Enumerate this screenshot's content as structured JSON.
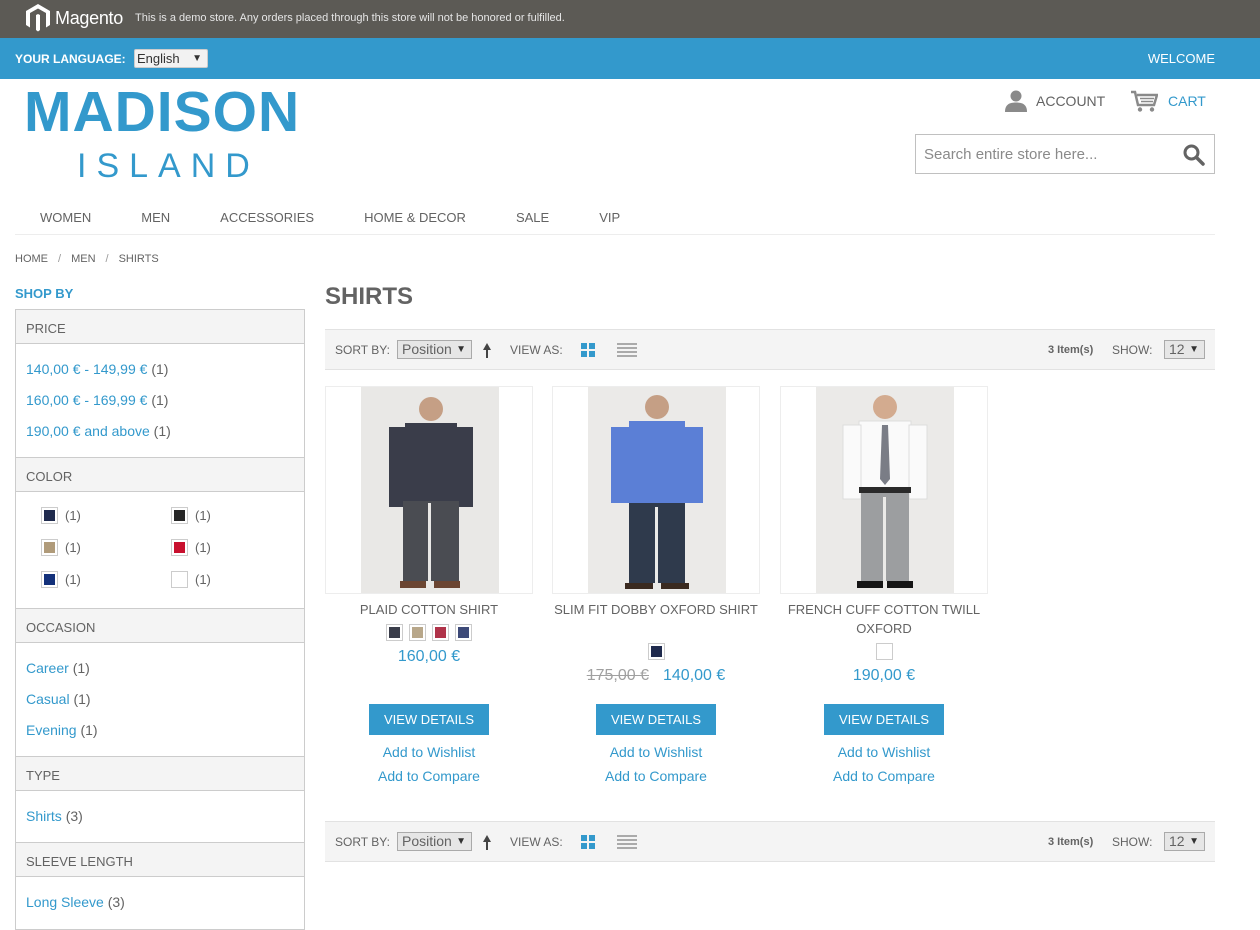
{
  "demo_bar": {
    "logo_text": "Magento",
    "notice": "This is a demo store. Any orders placed through this store will not be honored or fulfilled."
  },
  "language_bar": {
    "label": "YOUR LANGUAGE:",
    "selected": "English",
    "welcome": "WELCOME"
  },
  "header": {
    "logo_main": "MADISON",
    "logo_sub": "ISLAND",
    "account": "ACCOUNT",
    "cart": "CART",
    "search_placeholder": "Search entire store here..."
  },
  "nav": [
    "WOMEN",
    "MEN",
    "ACCESSORIES",
    "HOME & DECOR",
    "SALE",
    "VIP"
  ],
  "breadcrumb": [
    "HOME",
    "MEN",
    "SHIRTS"
  ],
  "sidebar": {
    "shop_by": "SHOP BY",
    "price": {
      "title": "PRICE",
      "items": [
        {
          "label": "140,00 € - 149,99 €",
          "count": "(1)"
        },
        {
          "label": "160,00 € - 169,99 €",
          "count": "(1)"
        },
        {
          "label": "190,00 € and above",
          "count": "(1)"
        }
      ]
    },
    "color": {
      "title": "COLOR",
      "items": [
        {
          "color": "#1f2a4d",
          "count": "(1)"
        },
        {
          "color": "#262626",
          "count": "(1)"
        },
        {
          "color": "#b09b7a",
          "count": "(1)"
        },
        {
          "color": "#c8102e",
          "count": "(1)"
        },
        {
          "color": "#13307a",
          "count": "(1)"
        },
        {
          "color": "#ffffff",
          "count": "(1)"
        }
      ]
    },
    "occasion": {
      "title": "OCCASION",
      "items": [
        {
          "label": "Career",
          "count": "(1)"
        },
        {
          "label": "Casual",
          "count": "(1)"
        },
        {
          "label": "Evening",
          "count": "(1)"
        }
      ]
    },
    "type": {
      "title": "TYPE",
      "items": [
        {
          "label": "Shirts",
          "count": "(3)"
        }
      ]
    },
    "sleeve": {
      "title": "SLEEVE LENGTH",
      "items": [
        {
          "label": "Long Sleeve",
          "count": "(3)"
        }
      ]
    }
  },
  "main": {
    "title": "SHIRTS",
    "toolbar": {
      "sort_by": "SORT BY:",
      "sort_value": "Position",
      "view_as": "VIEW AS:",
      "items": "3 Item(s)",
      "show": "SHOW:",
      "show_value": "12"
    },
    "products": [
      {
        "name": "PLAID COTTON SHIRT",
        "price": "160,00 €",
        "swatches": [
          "#3a3d4a",
          "#b8a78a",
          "#b0334a",
          "#3d4a78"
        ],
        "button": "VIEW DETAILS",
        "wishlist": "Add to Wishlist",
        "compare": "Add to Compare"
      },
      {
        "name": "SLIM FIT DOBBY OXFORD SHIRT",
        "old_price": "175,00 €",
        "price": "140,00 €",
        "swatches": [
          "#1f2a4d"
        ],
        "button": "VIEW DETAILS",
        "wishlist": "Add to Wishlist",
        "compare": "Add to Compare"
      },
      {
        "name": "FRENCH CUFF COTTON TWILL OXFORD",
        "price": "190,00 €",
        "swatches": [
          "#ffffff"
        ],
        "button": "VIEW DETAILS",
        "wishlist": "Add to Wishlist",
        "compare": "Add to Compare"
      }
    ]
  },
  "colors": {
    "accent": "#3399cc",
    "demo_bar": "#5c5a55",
    "text": "#636363"
  }
}
